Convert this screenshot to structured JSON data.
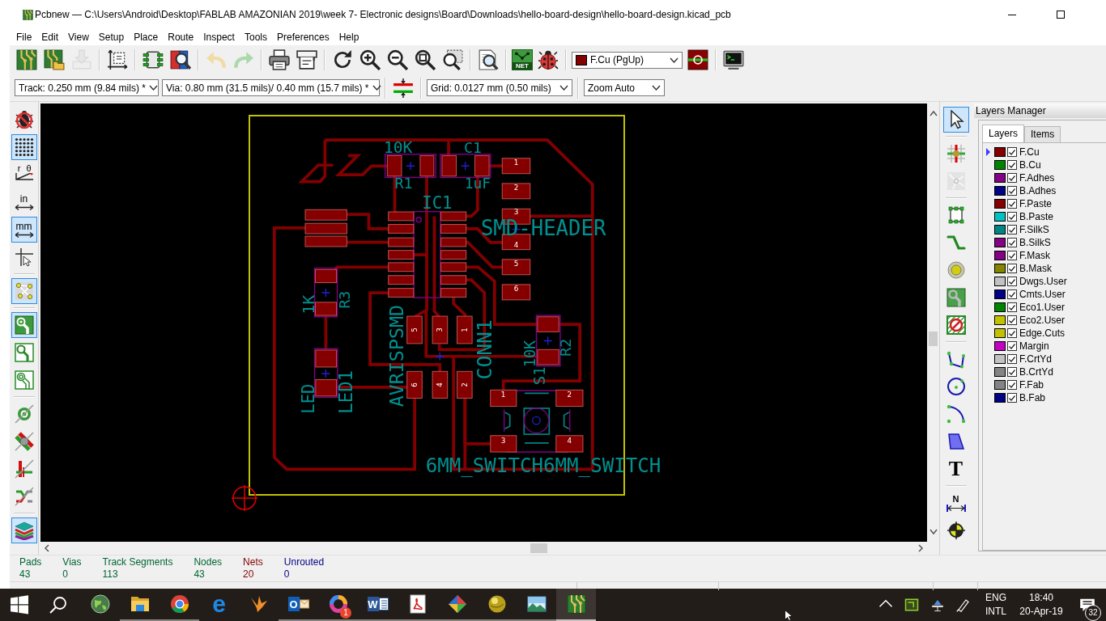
{
  "window": {
    "title": "Pcbnew — C:\\Users\\Android\\Desktop\\FABLAB AMAZONIAN 2019\\week 7- Electronic designs\\Board\\Downloads\\hello-board-design\\hello-board-design.kicad_pcb"
  },
  "menu": [
    "File",
    "Edit",
    "View",
    "Setup",
    "Place",
    "Route",
    "Inspect",
    "Tools",
    "Preferences",
    "Help"
  ],
  "main_toolbar": {
    "tools": [
      {
        "disabled": false
      },
      {
        "disabled": false
      },
      {
        "disabled": true
      },
      {
        "disabled": false
      },
      {
        "disabled": false
      },
      {
        "disabled": false
      },
      {
        "disabled": true
      },
      {
        "disabled": true
      },
      {
        "disabled": false
      },
      {
        "disabled": false
      },
      {
        "disabled": false
      },
      {
        "disabled": false
      },
      {
        "disabled": false
      },
      {
        "disabled": false
      },
      {
        "disabled": false
      },
      {
        "disabled": false
      },
      {
        "disabled": false,
        "label": "NET"
      },
      {
        "disabled": false
      }
    ],
    "layer_select": "F.Cu (PgUp)"
  },
  "options_bar": {
    "track_width": "Track: 0.250 mm (9.84 mils) *",
    "via_size": "Via: 0.80 mm (31.5 mils)/ 0.40 mm (15.7 mils) *",
    "grid": "Grid: 0.0127 mm (0.50 mils)",
    "zoom": "Zoom Auto"
  },
  "left_toolbar": [
    {
      "on": false
    },
    {
      "on": true
    },
    {
      "on": false,
      "labels": [
        "r",
        "θ"
      ]
    },
    {
      "on": false,
      "label": "in"
    },
    {
      "on": true,
      "label": "mm"
    },
    {
      "on": false
    },
    {
      "on": true
    },
    {
      "on": true
    },
    {
      "on": false
    },
    {
      "on": false
    },
    {
      "on": false
    },
    {
      "on": false
    },
    {
      "on": false
    },
    {
      "on": false
    },
    {
      "on": true
    }
  ],
  "board": {
    "footprints": [
      {
        "texts": [
          "10K",
          "R1"
        ]
      },
      {
        "texts": [
          "C1",
          "1uF"
        ]
      },
      {
        "texts": [
          "IC1"
        ]
      },
      {
        "texts": [
          "SMD-HEADER"
        ],
        "pad_numbers": [
          "1",
          "2",
          "3",
          "4",
          "5",
          "6"
        ]
      },
      {
        "texts": [
          "1K",
          "R3"
        ]
      },
      {
        "texts": [
          "LED",
          "LED1"
        ]
      },
      {
        "texts": [
          "AVRISPSMD",
          "CONN1"
        ],
        "pad_numbers": [
          "5",
          "3",
          "1",
          "6",
          "4",
          "2"
        ]
      },
      {
        "texts": [
          "10K",
          "R2"
        ]
      },
      {
        "texts": [
          "S1",
          "6MM_SWITCH6MM_SWITCH"
        ],
        "pad_numbers": [
          "1",
          "2",
          "3",
          "4"
        ]
      }
    ]
  },
  "right_toolbar": [
    {
      "on": true,
      "disabled": false
    },
    {
      "on": false,
      "disabled": false
    },
    {
      "on": false,
      "disabled": true
    },
    {
      "on": false,
      "disabled": false
    },
    {
      "on": false,
      "disabled": false
    },
    {
      "on": false,
      "disabled": false
    },
    {
      "on": false,
      "disabled": false
    },
    {
      "on": false,
      "disabled": false
    },
    {
      "on": false,
      "disabled": false
    },
    {
      "on": false,
      "disabled": false
    },
    {
      "on": false,
      "disabled": false
    },
    {
      "on": false,
      "disabled": false
    },
    {
      "on": false,
      "disabled": false,
      "label": "T"
    },
    {
      "on": false,
      "disabled": false,
      "label": "N"
    },
    {
      "on": false,
      "disabled": false
    }
  ],
  "layers_manager": {
    "title": "Layers Manager",
    "tabs": [
      {
        "label": "Layers",
        "selected": true
      },
      {
        "label": "Items",
        "selected": false
      }
    ],
    "layers": [
      {
        "name": "F.Cu",
        "color": "#840000",
        "visible": true,
        "active": true
      },
      {
        "name": "B.Cu",
        "color": "#008400",
        "visible": true,
        "active": false
      },
      {
        "name": "F.Adhes",
        "color": "#840084",
        "visible": true,
        "active": false
      },
      {
        "name": "B.Adhes",
        "color": "#000084",
        "visible": true,
        "active": false
      },
      {
        "name": "F.Paste",
        "color": "#840000",
        "visible": true,
        "active": false
      },
      {
        "name": "B.Paste",
        "color": "#00c2c2",
        "visible": true,
        "active": false
      },
      {
        "name": "F.SilkS",
        "color": "#008484",
        "visible": true,
        "active": false
      },
      {
        "name": "B.SilkS",
        "color": "#840084",
        "visible": true,
        "active": false
      },
      {
        "name": "F.Mask",
        "color": "#840084",
        "visible": true,
        "active": false
      },
      {
        "name": "B.Mask",
        "color": "#848400",
        "visible": true,
        "active": false
      },
      {
        "name": "Dwgs.User",
        "color": "#c2c2c2",
        "visible": true,
        "active": false
      },
      {
        "name": "Cmts.User",
        "color": "#000084",
        "visible": true,
        "active": false
      },
      {
        "name": "Eco1.User",
        "color": "#008400",
        "visible": true,
        "active": false
      },
      {
        "name": "Eco2.User",
        "color": "#c2c200",
        "visible": true,
        "active": false
      },
      {
        "name": "Edge.Cuts",
        "color": "#c2c200",
        "visible": true,
        "active": false
      },
      {
        "name": "Margin",
        "color": "#c200c2",
        "visible": true,
        "active": false
      },
      {
        "name": "F.CrtYd",
        "color": "#c2c2c2",
        "visible": true,
        "active": false
      },
      {
        "name": "B.CrtYd",
        "color": "#848484",
        "visible": true,
        "active": false
      },
      {
        "name": "F.Fab",
        "color": "#848484",
        "visible": true,
        "active": false
      },
      {
        "name": "B.Fab",
        "color": "#000084",
        "visible": true,
        "active": false
      }
    ]
  },
  "message_panel": [
    {
      "label": "Pads",
      "value": "43",
      "color": "#006633"
    },
    {
      "label": "Vias",
      "value": "0",
      "color": "#006633"
    },
    {
      "label": "Track Segments",
      "value": "113",
      "color": "#006633"
    },
    {
      "label": "Nodes",
      "value": "43",
      "color": "#006633"
    },
    {
      "label": "Nets",
      "value": "20",
      "color": "#840000"
    },
    {
      "label": "Unrouted",
      "value": "0",
      "color": "#000084"
    }
  ],
  "taskbar": {
    "apps": [
      {
        "running": false,
        "active": false
      },
      {
        "running": true,
        "active": false
      },
      {
        "running": true,
        "active": false
      },
      {
        "running": false,
        "active": false,
        "label": "e"
      },
      {
        "running": false,
        "active": false
      },
      {
        "running": true,
        "active": false,
        "label": "O"
      },
      {
        "running": true,
        "active": false,
        "badge": "1"
      },
      {
        "running": true,
        "active": false,
        "label": "W"
      },
      {
        "running": true,
        "active": false
      },
      {
        "running": true,
        "active": false
      },
      {
        "running": true,
        "active": false
      },
      {
        "running": true,
        "active": false
      },
      {
        "running": true,
        "active": true
      }
    ],
    "language": [
      "ENG",
      "INTL"
    ],
    "time": "18:40",
    "date": "20-Apr-19",
    "notifications": "32"
  }
}
